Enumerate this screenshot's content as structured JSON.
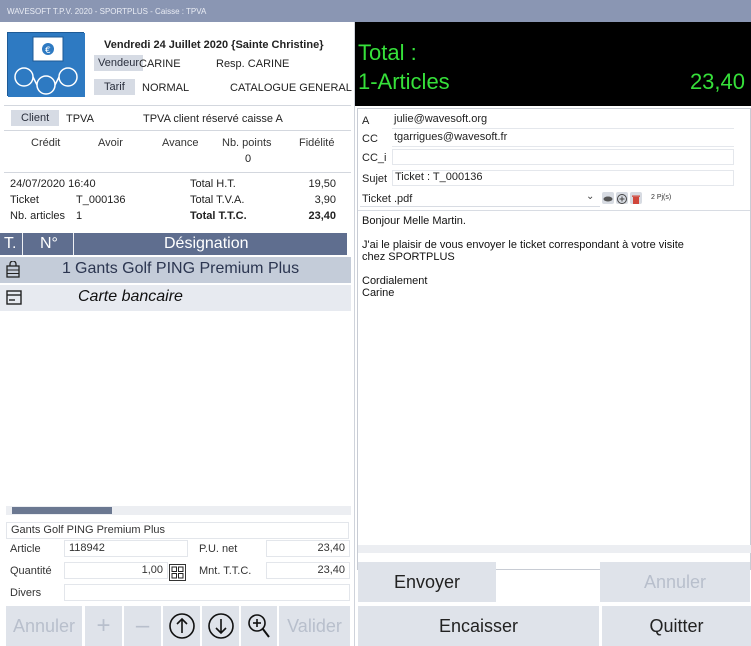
{
  "window": {
    "title": "WAVESOFT T.P.V. 2020 - SPORTPLUS - Caisse : TPVA"
  },
  "header": {
    "date": "Vendredi 24 Juillet 2020  {Sainte Christine}",
    "vendeur_label": "Vendeur",
    "vendeur_value": "CARINE",
    "resp": "Resp. CARINE",
    "tarif_label": "Tarif",
    "tarif_value": "NORMAL",
    "catalogue": "CATALOGUE GENERAL"
  },
  "client": {
    "label": "Client",
    "value": "TPVA",
    "description": "TPVA client réservé caisse A",
    "columns": [
      "Crédit",
      "Avoir",
      "Avance",
      "Nb. points",
      "Fidélité"
    ],
    "points": "0"
  },
  "ticket": {
    "datetime": "24/07/2020 16:40",
    "ticket_label": "Ticket",
    "ticket_value": "T_000136",
    "nb_articles_label": "Nb. articles",
    "nb_articles_value": "1",
    "total_ht_label": "Total H.T.",
    "total_ht_value": "19,50",
    "total_tva_label": "Total T.V.A.",
    "total_tva_value": "3,90",
    "total_ttc_label": "Total T.T.C.",
    "total_ttc_value": "23,40"
  },
  "grid": {
    "headers": [
      "T.",
      "N°",
      "Désignation"
    ],
    "rows": [
      {
        "num": "1",
        "designation": "Gants Golf PING Premium Plus",
        "icon": "basket-icon"
      },
      {
        "num": "",
        "designation": "Carte bancaire",
        "icon": "credit-card-icon"
      }
    ]
  },
  "detail": {
    "designation": "Gants Golf PING Premium Plus",
    "article_label": "Article",
    "article_value": "118942",
    "pu_label": "P.U. net",
    "pu_value": "23,40",
    "qty_label": "Quantité",
    "qty_value": "1,00",
    "mnt_label": "Mnt. T.T.C.",
    "mnt_value": "23,40",
    "divers_label": "Divers"
  },
  "left_buttons": {
    "annuler": "Annuler",
    "plus": "+",
    "minus": "–",
    "valider": "Valider"
  },
  "total": {
    "label": "Total :",
    "line": "1-Articles",
    "amount": "23,40"
  },
  "mail": {
    "to_label": "A",
    "to_value": "julie@wavesoft.org",
    "cc_label": "CC",
    "cc_value": "tgarrigues@wavesoft.fr",
    "cci_label": "CC_i",
    "cci_value": "",
    "subject_label": "Sujet",
    "subject_value": "Ticket : T_000136",
    "attachment": "Ticket .pdf",
    "attach_count": "2 Pj(s)",
    "body": "Bonjour Melle Martin.\n\nJ'ai le plaisir de vous envoyer le ticket correspondant à votre visite\nchez SPORTPLUS\n\nCordialement\nCarine"
  },
  "right_buttons": {
    "envoyer": "Envoyer",
    "annuler": "Annuler",
    "encaisser": "Encaisser",
    "quitter": "Quitter"
  },
  "colors": {
    "title_bar": "#8a96b3",
    "grid_header": "#5f6e8f",
    "total_text": "#36e03a",
    "logo": "#2e7ac2"
  }
}
